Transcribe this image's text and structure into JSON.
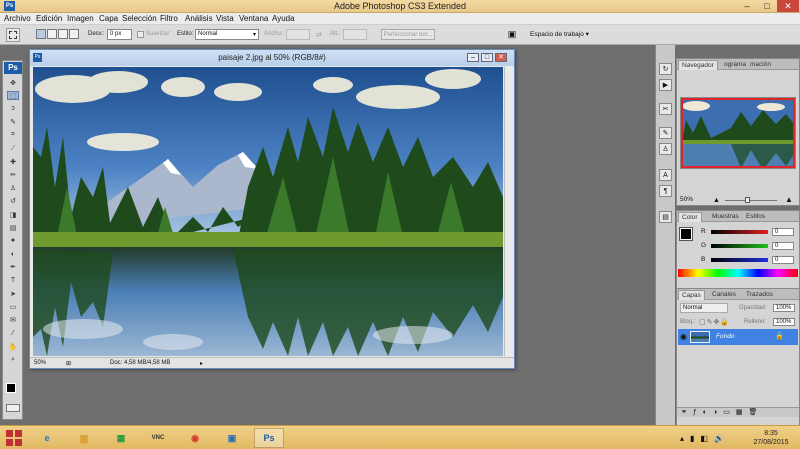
{
  "app": {
    "title": "Adobe Photoshop CS3 Extended"
  },
  "window_controls": {
    "minimize": "–",
    "maximize": "□",
    "close": "✕"
  },
  "menu": [
    "Archivo",
    "Edición",
    "Imagen",
    "Capa",
    "Selección",
    "Filtro",
    "Análisis",
    "Vista",
    "Ventana",
    "Ayuda"
  ],
  "options_bar": {
    "feather_label": "Desv.:",
    "feather_value": "0 px",
    "antialias_label": "Suavizar",
    "style_label": "Estilo:",
    "style_value": "Normal",
    "width_label": "Anchu.:",
    "height_label": "Alt.:",
    "refine_label": "Perfeccionar bor...",
    "workspace_label": "Espacio de trabajo"
  },
  "toolbox": {
    "badge": "Ps",
    "tools": [
      {
        "name": "move-tool-icon",
        "glyph": "✥"
      },
      {
        "name": "marquee-tool-icon",
        "glyph": "⬚",
        "active": true
      },
      {
        "name": "lasso-tool-icon",
        "glyph": "ↄ"
      },
      {
        "name": "quick-select-tool-icon",
        "glyph": "✎"
      },
      {
        "name": "crop-tool-icon",
        "glyph": "⌗"
      },
      {
        "name": "slice-tool-icon",
        "glyph": "⟋"
      },
      {
        "name": "healing-brush-icon",
        "glyph": "✚"
      },
      {
        "name": "brush-tool-icon",
        "glyph": "✏"
      },
      {
        "name": "clone-stamp-icon",
        "glyph": "♙"
      },
      {
        "name": "history-brush-icon",
        "glyph": "↺"
      },
      {
        "name": "eraser-tool-icon",
        "glyph": "◨"
      },
      {
        "name": "gradient-tool-icon",
        "glyph": "▤"
      },
      {
        "name": "blur-tool-icon",
        "glyph": "●"
      },
      {
        "name": "dodge-tool-icon",
        "glyph": "◐"
      },
      {
        "name": "pen-tool-icon",
        "glyph": "✒"
      },
      {
        "name": "type-tool-icon",
        "glyph": "T"
      },
      {
        "name": "path-select-icon",
        "glyph": "➤"
      },
      {
        "name": "shape-tool-icon",
        "glyph": "▭"
      },
      {
        "name": "notes-tool-icon",
        "glyph": "✉"
      },
      {
        "name": "eyedropper-tool-icon",
        "glyph": "⁄"
      },
      {
        "name": "hand-tool-icon",
        "glyph": "✋"
      },
      {
        "name": "zoom-tool-icon",
        "glyph": "⌕"
      }
    ]
  },
  "document": {
    "title": "paisaje 2.jpg al 50% (RGB/8#)",
    "zoom": "50%",
    "doc_info": "Doc: 4,58 MB/4,58 MB"
  },
  "navigator": {
    "tabs": [
      "Navegador",
      "ograma",
      "mación"
    ],
    "zoom": "50%"
  },
  "color_panel": {
    "tabs": [
      "Color",
      "Muestras",
      "Estilos"
    ],
    "channels": [
      {
        "label": "R",
        "value": "0",
        "color": "#e02020"
      },
      {
        "label": "G",
        "value": "0",
        "color": "#20c020"
      },
      {
        "label": "B",
        "value": "0",
        "color": "#2030e0"
      }
    ]
  },
  "layers_panel": {
    "tabs": [
      "Capas",
      "Canales",
      "Trazados"
    ],
    "blend_mode": "Normal",
    "opacity_label": "Opacidad:",
    "opacity_value": "100%",
    "lock_label": "Bloq.:",
    "fill_label": "Relleno:",
    "fill_value": "100%",
    "layer_name": "Fondo"
  },
  "taskbar": {
    "apps": [
      {
        "name": "ie-icon",
        "glyph": "e",
        "color": "#1e78d2"
      },
      {
        "name": "file-explorer-icon",
        "glyph": "▆",
        "color": "#d9a23a"
      },
      {
        "name": "store-icon",
        "glyph": "▦",
        "color": "#2a9a3a"
      },
      {
        "name": "vnc-icon",
        "glyph": "VNC",
        "color": "#333"
      },
      {
        "name": "chrome-icon",
        "glyph": "◉",
        "color": "#d23c2c"
      },
      {
        "name": "remote-desktop-icon",
        "glyph": "▣",
        "color": "#2a6fb5"
      },
      {
        "name": "photoshop-icon",
        "glyph": "Ps",
        "color": "#1d5ca8",
        "active": true
      }
    ],
    "time": "8:35",
    "date": "27/08/2015"
  }
}
